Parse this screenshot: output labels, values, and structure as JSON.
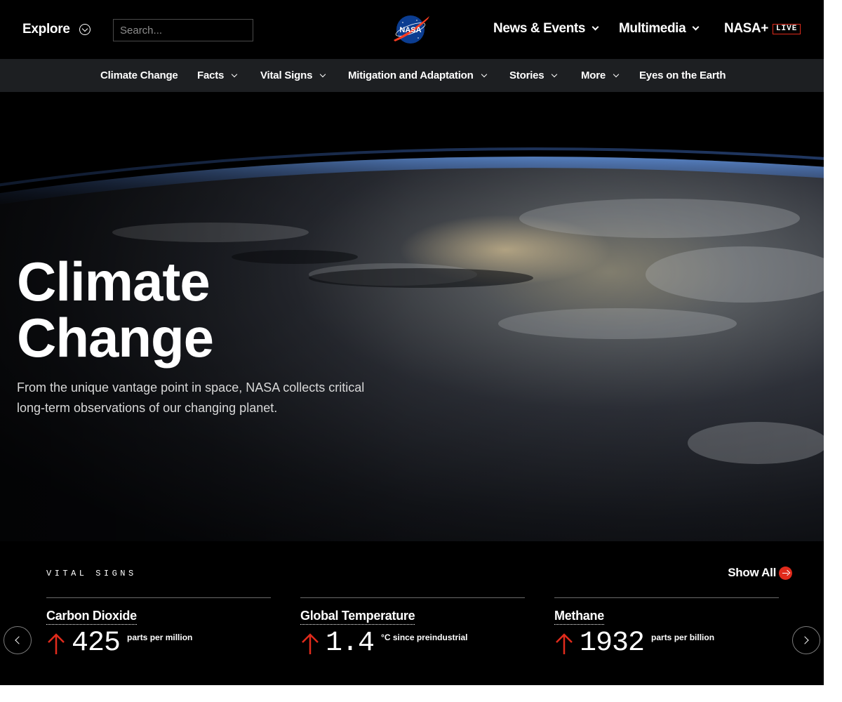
{
  "header": {
    "explore_label": "Explore",
    "search_placeholder": "Search...",
    "logo_text": "NASA",
    "nav": [
      {
        "label": "News & Events"
      },
      {
        "label": "Multimedia"
      },
      {
        "label": "NASA+"
      }
    ],
    "live_badge": "LIVE"
  },
  "subnav": {
    "items": [
      {
        "label": "Climate Change"
      },
      {
        "label": "Facts"
      },
      {
        "label": "Vital Signs"
      },
      {
        "label": "Mitigation and Adaptation"
      },
      {
        "label": "Stories"
      },
      {
        "label": "More"
      },
      {
        "label": "Eyes on the Earth"
      }
    ]
  },
  "hero": {
    "title_line1": "Climate",
    "title_line2": "Change",
    "subtitle": "From the unique vantage point in space, NASA collects critical long-term observations of our changing planet."
  },
  "vitals": {
    "section_label": "VITAL SIGNS",
    "show_all_label": "Show All",
    "cards": [
      {
        "name": "Carbon Dioxide",
        "value": "425",
        "unit": "parts per million",
        "trend": "up"
      },
      {
        "name": "Global Temperature",
        "value": "1.4",
        "unit": "°C since preindustrial",
        "trend": "up"
      },
      {
        "name": "Methane",
        "value": "1932",
        "unit": "parts per billion",
        "trend": "up"
      }
    ]
  },
  "colors": {
    "accent_red": "#e12b1c",
    "background": "#000000",
    "subnav_bg": "#1d1f22"
  },
  "icons": {
    "explore_toggle": "chevron-down-circle-icon",
    "dropdown": "chevron-down-icon",
    "show_all": "arrow-right-circle-icon",
    "trend": "arrow-up-icon",
    "carousel_prev": "chevron-left-icon",
    "carousel_next": "chevron-right-icon"
  }
}
